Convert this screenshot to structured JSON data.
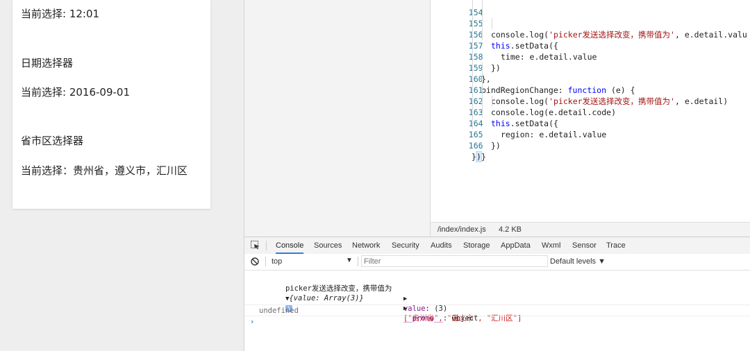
{
  "simulator": {
    "line1": "当前选择: 12:01",
    "date_title": "日期选择器",
    "date_value": "当前选择: 2016-09-01",
    "region_title": "省市区选择器",
    "region_value": "当前选择：贵州省，遵义市，汇川区"
  },
  "editor": {
    "file_path": "/index/index.js",
    "file_size": "4.2 KB",
    "lines": [
      {
        "n": "154",
        "t": "      console.log('picker发送选择改变，携带值为', e.detail.value)"
      },
      {
        "n": "155",
        "t": "      this.setData({"
      },
      {
        "n": "156",
        "t": "        time: e.detail.value"
      },
      {
        "n": "157",
        "t": "      })"
      },
      {
        "n": "158",
        "t": "    },"
      },
      {
        "n": "159",
        "t": "    bindRegionChange: function (e) {"
      },
      {
        "n": "160",
        "t": "      console.log('picker发送选择改变，携带值为', e.detail)"
      },
      {
        "n": "161",
        "t": "      console.log(e.detail.code)"
      },
      {
        "n": "162",
        "t": "      this.setData({"
      },
      {
        "n": "163",
        "t": "        region: e.detail.value"
      },
      {
        "n": "164",
        "t": "      })"
      },
      {
        "n": "165",
        "t": "    }"
      },
      {
        "n": "166",
        "t": "  })"
      }
    ]
  },
  "devtools": {
    "tabs": [
      "Console",
      "Sources",
      "Network",
      "Security",
      "Audits",
      "Storage",
      "AppData",
      "Wxml",
      "Sensor",
      "Trace"
    ],
    "active_tab": "Console",
    "context": "top",
    "filter_placeholder": "Filter",
    "levels": "Default levels ▼"
  },
  "console": {
    "log_label": "picker发送选择改变，携带值为",
    "object_preview": "{value: Array(3)}",
    "value_key": "value",
    "value_count": "(3)",
    "value_items": "[\"贵州省\", \"遵义市\", \"汇川区\"]",
    "proto_key": "__proto__",
    "proto_value": ": Object",
    "undefined_text": "undefined",
    "prompt": "›"
  },
  "colors": {
    "accent": "#3879d9",
    "keyword": "#0000ff",
    "string": "#a31515",
    "line_number": "#237893"
  }
}
